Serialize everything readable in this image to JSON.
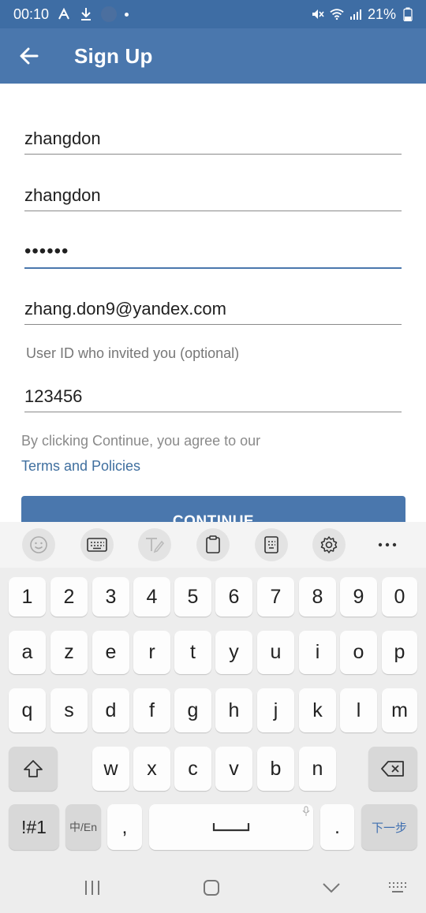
{
  "status": {
    "time": "00:10",
    "battery": "21%"
  },
  "header": {
    "title": "Sign Up"
  },
  "form": {
    "first_name": "zhangdon",
    "last_name": "zhangdon",
    "password_mask": "••••••",
    "email": "zhang.don9@yandex.com",
    "invite_hint": "User ID who invited you (optional)",
    "invite_value": "123456",
    "agree_text": "By clicking Continue, you agree to our",
    "terms_link": "Terms and Policies",
    "continue_label": "CONTINUE"
  },
  "keyboard": {
    "row_numbers": [
      "1",
      "2",
      "3",
      "4",
      "5",
      "6",
      "7",
      "8",
      "9",
      "0"
    ],
    "row1": [
      "a",
      "z",
      "e",
      "r",
      "t",
      "y",
      "u",
      "i",
      "o",
      "p"
    ],
    "row2": [
      "q",
      "s",
      "d",
      "f",
      "g",
      "h",
      "j",
      "k",
      "l",
      "m"
    ],
    "row3": [
      "w",
      "x",
      "c",
      "v",
      "b",
      "n"
    ],
    "symbols_label": "!#1",
    "lang_label": "中/En",
    "comma": ",",
    "period": ".",
    "next_label": "下一步"
  },
  "icons": [
    "back-arrow",
    "emoji",
    "keyboard",
    "handwriting",
    "clipboard",
    "one-handed",
    "settings",
    "more",
    "shift",
    "backspace",
    "space",
    "mic"
  ]
}
